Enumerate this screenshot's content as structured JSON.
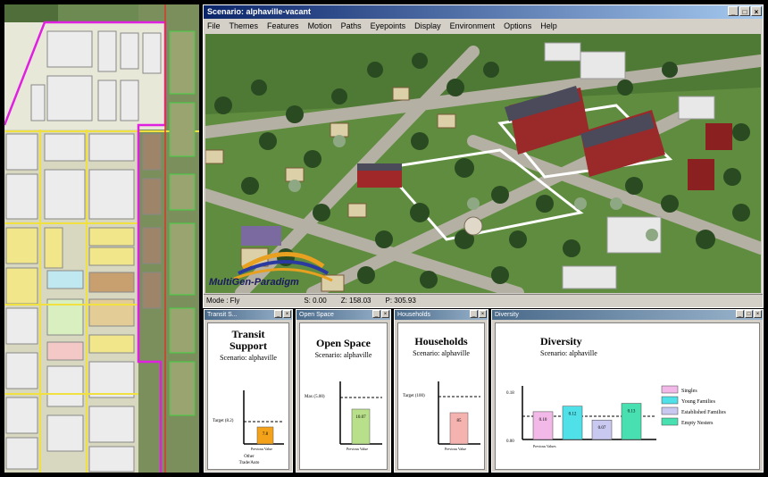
{
  "main_window": {
    "title": "Scenario: alphaville-vacant",
    "menu": [
      "File",
      "Themes",
      "Features",
      "Motion",
      "Paths",
      "Eyepoints",
      "Display",
      "Environment",
      "Options",
      "Help"
    ],
    "status": {
      "mode": "Mode : Fly",
      "s": "S:    0.00",
      "z": "Z:  158.03",
      "p": "P:  305.93"
    },
    "logo": "MultiGen-Paradigm"
  },
  "panels": {
    "transit": {
      "title": "Transit S...",
      "heading_line1": "Transit",
      "heading_line2": "Support",
      "scenario": "Scenario: alphaville",
      "target_label": "Target (8.2)",
      "bar_label": "7.8",
      "previous_label": "Previous Value",
      "footer_line1": "Other",
      "footer_line2": "Trade/Auto",
      "bar_color": "#f4a21a"
    },
    "openspace": {
      "title": "Open Space",
      "heading": "Open Space",
      "scenario": "Scenario: alphaville",
      "target_label": "Max (5.00)",
      "bar_label": "10.07",
      "previous_label": "Previous Value",
      "bar_color": "#b8e08a"
    },
    "households": {
      "title": "Households",
      "heading": "Households",
      "scenario": "Scenario: alphaville",
      "target_label": "Target (100)",
      "bar_label": "85",
      "previous_label": "Previous Value",
      "bar_color": "#f5b3b0"
    },
    "diversity": {
      "title": "Diversity",
      "heading": "Diversity",
      "scenario": "Scenario: alphaville",
      "axis_top": "0.18",
      "axis_bottom": "0.00",
      "previous_label": "Previous Values",
      "bars": [
        {
          "label": "0.10",
          "color": "#f2b8e8",
          "value": 0.1
        },
        {
          "label": "0.12",
          "color": "#4fe0e8",
          "value": 0.12
        },
        {
          "label": "0.07",
          "color": "#c8c8f0",
          "value": 0.07
        },
        {
          "label": "0.13",
          "color": "#48e0b0",
          "value": 0.13
        }
      ],
      "legend": [
        {
          "label": "Singles",
          "color": "#f2b8e8"
        },
        {
          "label": "Young Families",
          "color": "#4fe0e8"
        },
        {
          "label": "Established Families",
          "color": "#c8c8f0"
        },
        {
          "label": "Empty Nesters",
          "color": "#48e0b0"
        }
      ]
    }
  }
}
